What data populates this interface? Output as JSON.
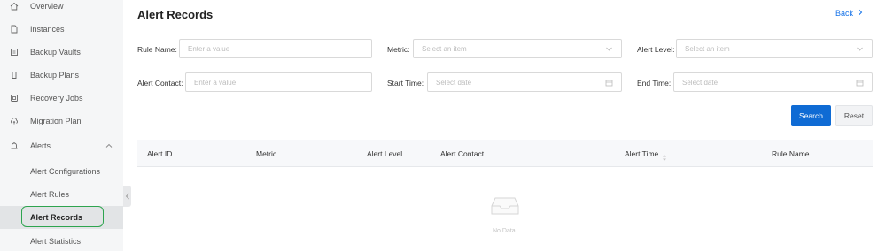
{
  "sidebar": {
    "items": [
      {
        "label": "Overview",
        "icon": "home-icon"
      },
      {
        "label": "Instances",
        "icon": "file-icon"
      },
      {
        "label": "Backup Vaults",
        "icon": "vault-icon"
      },
      {
        "label": "Backup Plans",
        "icon": "plan-icon"
      },
      {
        "label": "Recovery Jobs",
        "icon": "recovery-icon"
      },
      {
        "label": "Migration Plan",
        "icon": "cloud-icon"
      },
      {
        "label": "Alerts",
        "icon": "alert-icon"
      }
    ],
    "alerts_children": [
      {
        "label": "Alert Configurations"
      },
      {
        "label": "Alert Rules"
      },
      {
        "label": "Alert Records",
        "active": true
      },
      {
        "label": "Alert Statistics"
      }
    ]
  },
  "header": {
    "title": "Alert Records",
    "back_label": "Back"
  },
  "filters": {
    "rule_name": {
      "label": "Rule Name:",
      "placeholder": "Enter a value"
    },
    "metric": {
      "label": "Metric:",
      "placeholder": "Select an item"
    },
    "alert_level": {
      "label": "Alert Level:",
      "placeholder": "Select an item"
    },
    "alert_contact": {
      "label": "Alert Contact:",
      "placeholder": "Enter a value"
    },
    "start_time": {
      "label": "Start Time:",
      "placeholder": "Select date"
    },
    "end_time": {
      "label": "End Time:",
      "placeholder": "Select date"
    }
  },
  "actions": {
    "search_label": "Search",
    "reset_label": "Reset"
  },
  "table": {
    "columns": [
      "Alert ID",
      "Metric",
      "Alert Level",
      "Alert Contact",
      "Alert Time",
      "Rule Name"
    ],
    "empty_text": "No Data"
  },
  "colors": {
    "primary": "#0f6bd4",
    "link": "#1572e8",
    "active_ring": "#2ea44f"
  }
}
